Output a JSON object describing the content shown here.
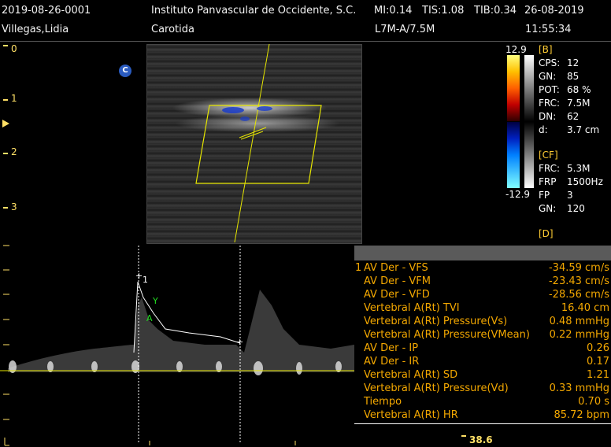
{
  "header": {
    "patient_id": "2019-08-26-0001",
    "patient_name": "Villegas,Lidia",
    "institution": "Instituto Panvascular de Occidente, S.C.",
    "mi": "MI:0.14",
    "tis": "TIS:1.08",
    "tib": "TIB:0.34",
    "date": "26-08-2019",
    "exam": "Carotida",
    "probe": "L7M-A/7.5M",
    "time": "11:55:34"
  },
  "depth_scale": [
    "0",
    "1",
    "2",
    "3"
  ],
  "cursor_marker": "C",
  "colorbar": {
    "top": "12.9",
    "bottom": "-12.9"
  },
  "b_mode": {
    "title": "[B]",
    "params": [
      {
        "k": "CPS:",
        "v": "12"
      },
      {
        "k": "GN:",
        "v": "85"
      },
      {
        "k": "POT:",
        "v": "68 %"
      },
      {
        "k": "FRC:",
        "v": "7.5M"
      },
      {
        "k": "DN:",
        "v": "62"
      },
      {
        "k": "d:",
        "v": "3.7 cm"
      }
    ]
  },
  "cf_mode": {
    "title": "[CF]",
    "params": [
      {
        "k": "FRC:",
        "v": "5.3M"
      },
      {
        "k": "FRP",
        "v": "1500Hz"
      },
      {
        "k": "FP",
        "v": "3"
      },
      {
        "k": "GN:",
        "v": "120"
      }
    ]
  },
  "d_mode": {
    "title": "[D]"
  },
  "measurements": [
    {
      "idx": "1",
      "label": "AV Der - VFS",
      "value": "-34.59 cm/s"
    },
    {
      "idx": "",
      "label": "AV Der - VFM",
      "value": "-23.43 cm/s"
    },
    {
      "idx": "",
      "label": "AV Der - VFD",
      "value": "-28.56 cm/s"
    },
    {
      "idx": "",
      "label": "Vertebral A(Rt) TVI",
      "value": "16.40 cm"
    },
    {
      "idx": "",
      "label": "Vertebral A(Rt) Pressure(Vs)",
      "value": "0.48 mmHg"
    },
    {
      "idx": "",
      "label": "Vertebral A(Rt) Pressure(VMean)",
      "value": "0.22 mmHg"
    },
    {
      "idx": "",
      "label": "AV Der - IP",
      "value": "0.26"
    },
    {
      "idx": "",
      "label": "AV Der - IR",
      "value": "0.17"
    },
    {
      "idx": "",
      "label": "Vertebral A(Rt) SD",
      "value": "1.21"
    },
    {
      "idx": "",
      "label": "Vertebral A(Rt) Pressure(Vd)",
      "value": "0.33 mmHg"
    },
    {
      "idx": "",
      "label": "Tiempo",
      "value": "0.70 s"
    },
    {
      "idx": "",
      "label": "Vertebral A(Rt) HR",
      "value": "85.72 bpm"
    }
  ],
  "cursor_labels": {
    "peak": "1"
  },
  "bottom_readout": "38.6"
}
